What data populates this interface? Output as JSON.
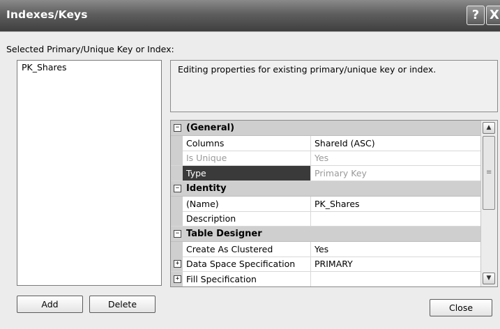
{
  "window": {
    "title": "Indexes/Keys",
    "help_label": "?",
    "close_label": "X"
  },
  "selected_label": "Selected Primary/Unique Key or Index:",
  "keys_list": {
    "items": [
      "PK_Shares"
    ]
  },
  "description": "Editing properties for existing primary/unique key or index.",
  "property_grid": {
    "rows": [
      {
        "kind": "category",
        "toggle": "⊟",
        "name": "(General)"
      },
      {
        "kind": "prop",
        "name": "Columns",
        "value": "ShareId (ASC)"
      },
      {
        "kind": "prop",
        "name": "Is Unique",
        "value": "Yes",
        "dim": true
      },
      {
        "kind": "prop",
        "name": "Type",
        "value": "Primary Key",
        "selected": true,
        "dim": true
      },
      {
        "kind": "category",
        "toggle": "⊟",
        "name": "Identity"
      },
      {
        "kind": "prop",
        "name": "(Name)",
        "value": "PK_Shares"
      },
      {
        "kind": "prop",
        "name": "Description",
        "value": ""
      },
      {
        "kind": "category",
        "toggle": "⊟",
        "name": "Table Designer"
      },
      {
        "kind": "prop",
        "name": "Create As Clustered",
        "value": "Yes"
      },
      {
        "kind": "expandable",
        "toggle": "⊞",
        "name": "Data Space Specification",
        "value": "PRIMARY"
      },
      {
        "kind": "expandable",
        "toggle": "⊞",
        "name": "Fill Specification",
        "value": ""
      }
    ]
  },
  "buttons": {
    "add": "Add",
    "delete": "Delete",
    "close": "Close"
  },
  "icons": {
    "scroll_up": "chevron-up-icon",
    "scroll_down": "chevron-down-icon",
    "expand": "plus-box-icon",
    "collapse": "minus-box-icon"
  },
  "colors": {
    "selected_row": "#3a3a3a",
    "category_bg": "#cfcfcf",
    "titlebar": "#5e5e5e"
  }
}
